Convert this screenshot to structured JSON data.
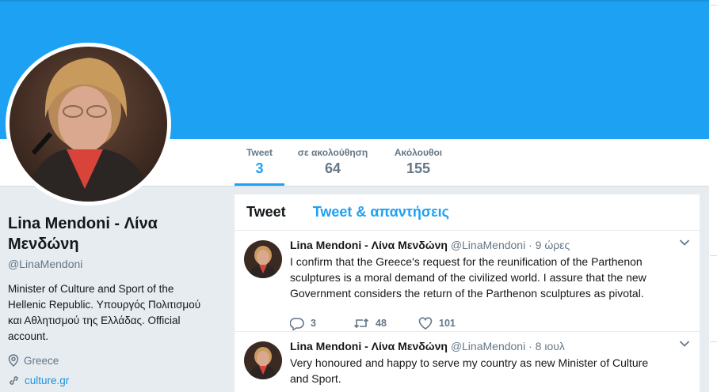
{
  "nav": {
    "tweets": {
      "label": "Tweet",
      "value": "3"
    },
    "following": {
      "label": "σε ακολούθηση",
      "value": "64"
    },
    "followers": {
      "label": "Ακόλουθοι",
      "value": "155"
    }
  },
  "profile": {
    "name": "Lina Mendoni - Λίνα Μενδώνη",
    "handle": "@LinaMendoni",
    "bio": "Minister of Culture and Sport of the Hellenic Republic. Υπουργός Πολιτισμού και Αθλητισμού της Ελλάδας. Official account.",
    "location": "Greece",
    "website": "culture.gr",
    "location_icon": "location-pin-icon",
    "link_icon": "link-icon"
  },
  "tabs": {
    "tweets": "Tweet",
    "tweets_replies": "Tweet & απαντήσεις"
  },
  "tweets": [
    {
      "name": "Lina Mendoni - Λίνα Μενδώνη",
      "handle": "@LinaMendoni",
      "time": "9 ώρες",
      "text": "I confirm that the Greece's request for the reunification of the Parthenon sculptures is a moral demand of the civilized world. I assure that the new Government considers the return of the Parthenon sculptures as pivotal.",
      "replies": "3",
      "retweets": "48",
      "likes": "101"
    },
    {
      "name": "Lina Mendoni - Λίνα Μενδώνη",
      "handle": "@LinaMendoni",
      "time": "8 ιουλ",
      "text": "Very honoured and happy to serve my country as new Minister of Culture and Sport."
    }
  ],
  "colors": {
    "brand": "#1da1f2",
    "background": "#e6ecf0",
    "secondary_text": "#657786"
  }
}
